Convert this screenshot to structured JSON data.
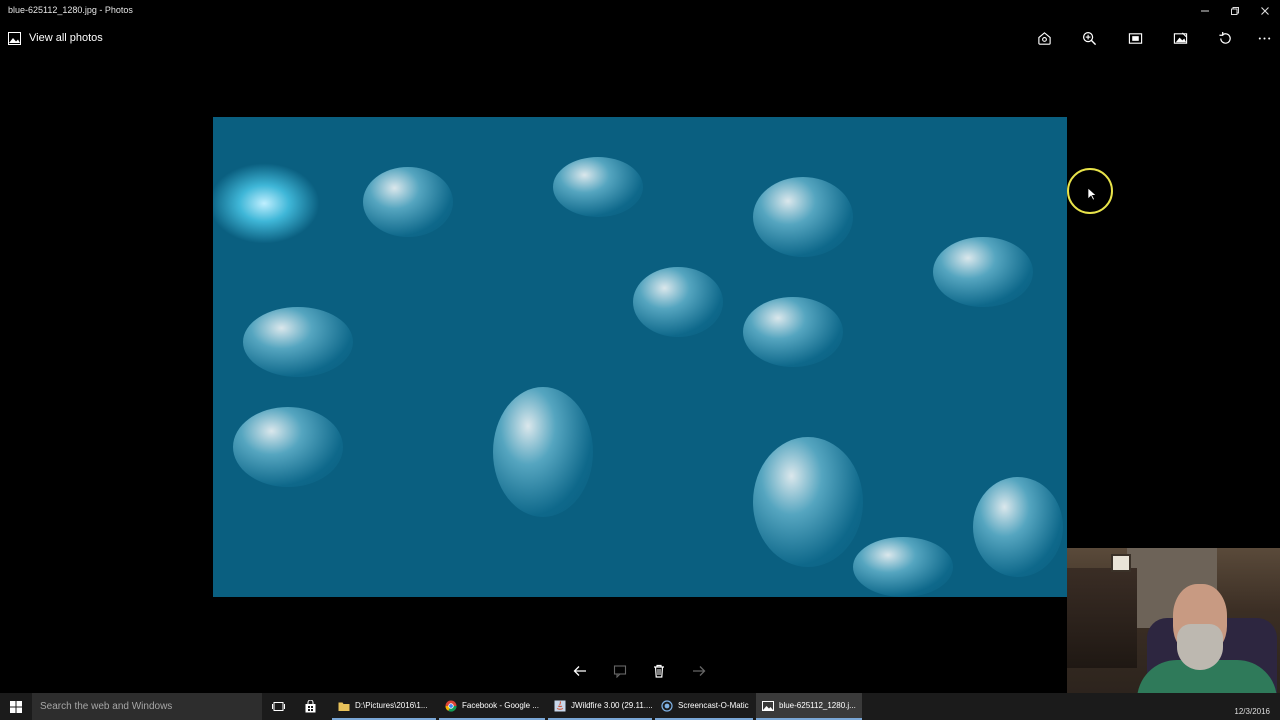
{
  "window": {
    "title": "blue-625112_1280.jpg - Photos",
    "controls": [
      "minimize-icon",
      "restore-icon",
      "close-icon"
    ]
  },
  "toolbar": {
    "view_all_label": "View all photos",
    "view_all_icon": "photo-icon",
    "actions": [
      {
        "name": "share",
        "icon": "share-icon"
      },
      {
        "name": "zoom",
        "icon": "zoom-in-icon"
      },
      {
        "name": "slideshow",
        "icon": "slideshow-icon"
      },
      {
        "name": "edit",
        "icon": "edit-image-icon"
      },
      {
        "name": "rotate",
        "icon": "rotate-icon"
      },
      {
        "name": "more",
        "icon": "more-icon"
      }
    ]
  },
  "photo": {
    "description_icon": "image",
    "accent": "#1a8fb4"
  },
  "bottom_nav": {
    "icons": [
      "arrow-left-icon",
      "comment-icon",
      "delete-icon",
      "arrow-right-icon"
    ]
  },
  "taskbar": {
    "search_placeholder": "Search the web and Windows",
    "apps": [
      {
        "label": "D:\\Pictures\\2016\\1...",
        "icon": "folder-icon"
      },
      {
        "label": "Facebook - Google ...",
        "icon": "chrome-icon"
      },
      {
        "label": "JWildfire 3.00 (29.11....",
        "icon": "java-icon"
      },
      {
        "label": "Screencast-O-Matic",
        "icon": "record-icon"
      },
      {
        "label": "blue-625112_1280.j...",
        "icon": "photos-icon"
      }
    ],
    "date": "12/3/2016",
    "accent": "#7aa7d6"
  }
}
